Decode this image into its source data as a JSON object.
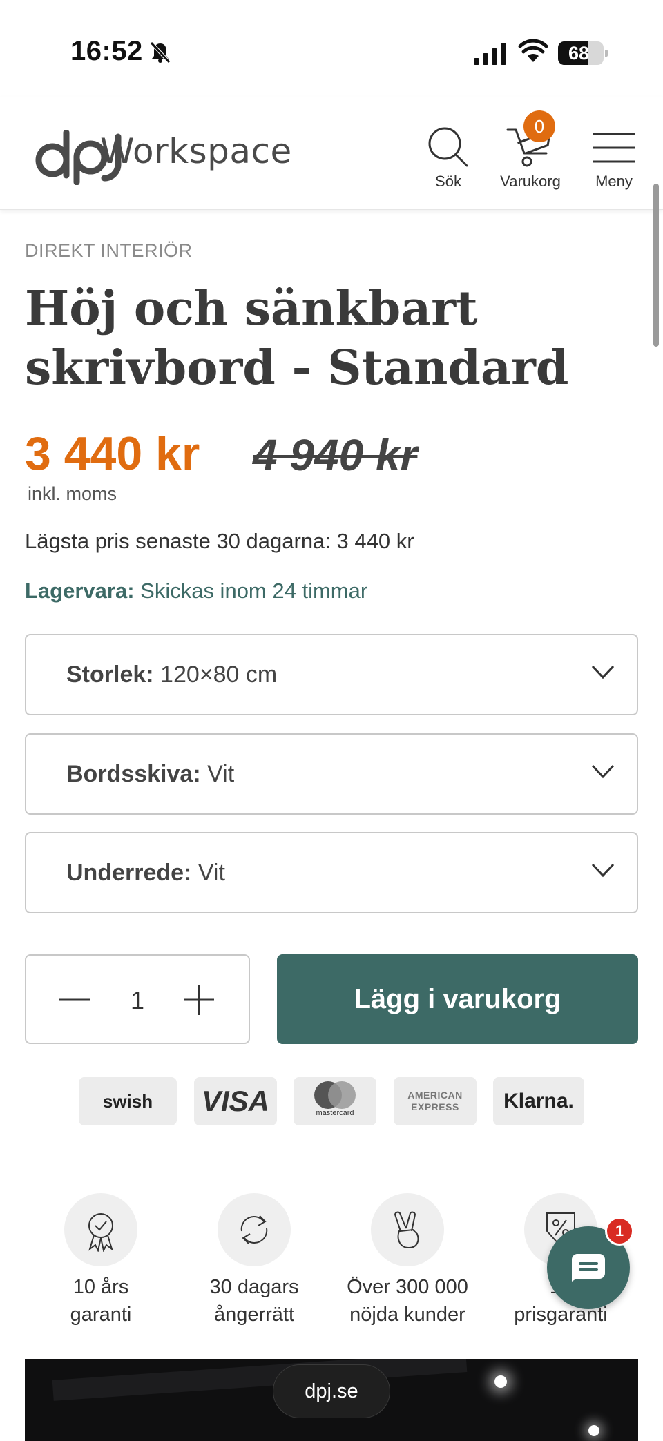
{
  "status_bar": {
    "time": "16:52",
    "battery": "68"
  },
  "header": {
    "logo_text": "Workspace",
    "search_label": "Sök",
    "cart_label": "Varukorg",
    "cart_count": "0",
    "menu_label": "Meny"
  },
  "product": {
    "brand": "DIREKT INTERIÖR",
    "title": "Höj och sänkbart skrivbord - Standard",
    "price": "3 440 kr",
    "old_price": "4 940 kr",
    "vat_note": "inkl. moms",
    "lowest_price": "Lägsta pris senaste 30 dagarna: 3 440 kr",
    "stock_label": "Lagervara:",
    "stock_text": " Skickas inom 24 timmar"
  },
  "options": [
    {
      "label": "Storlek:",
      "value": " 120×80 cm"
    },
    {
      "label": "Bordsskiva:",
      "value": " Vit"
    },
    {
      "label": "Underrede:",
      "value": " Vit"
    }
  ],
  "cart_form": {
    "quantity": "1",
    "add_label": "Lägg i varukorg"
  },
  "payments": {
    "swish": "swish",
    "visa": "VISA",
    "mastercard": "mastercard",
    "amex": "AMERICAN EXPRESS",
    "klarna": "Klarna."
  },
  "usps": [
    {
      "line1": "10 års",
      "line2": "garanti",
      "icon": "award-ribbon-icon"
    },
    {
      "line1": "30 dagars",
      "line2": "ångerrätt",
      "icon": "return-arrows-icon"
    },
    {
      "line1": "Över 300 000",
      "line2": "nöjda kunder",
      "icon": "peace-hand-icon"
    },
    {
      "line1": "10",
      "line2": "prisgaranti",
      "icon": "price-tag-percent-icon"
    }
  ],
  "chat": {
    "badge": "1"
  },
  "browser": {
    "url": "dpj.se"
  },
  "colors": {
    "accent_orange": "#e06c10",
    "brand_green": "#3d6a66",
    "badge_red": "#d92b23"
  }
}
